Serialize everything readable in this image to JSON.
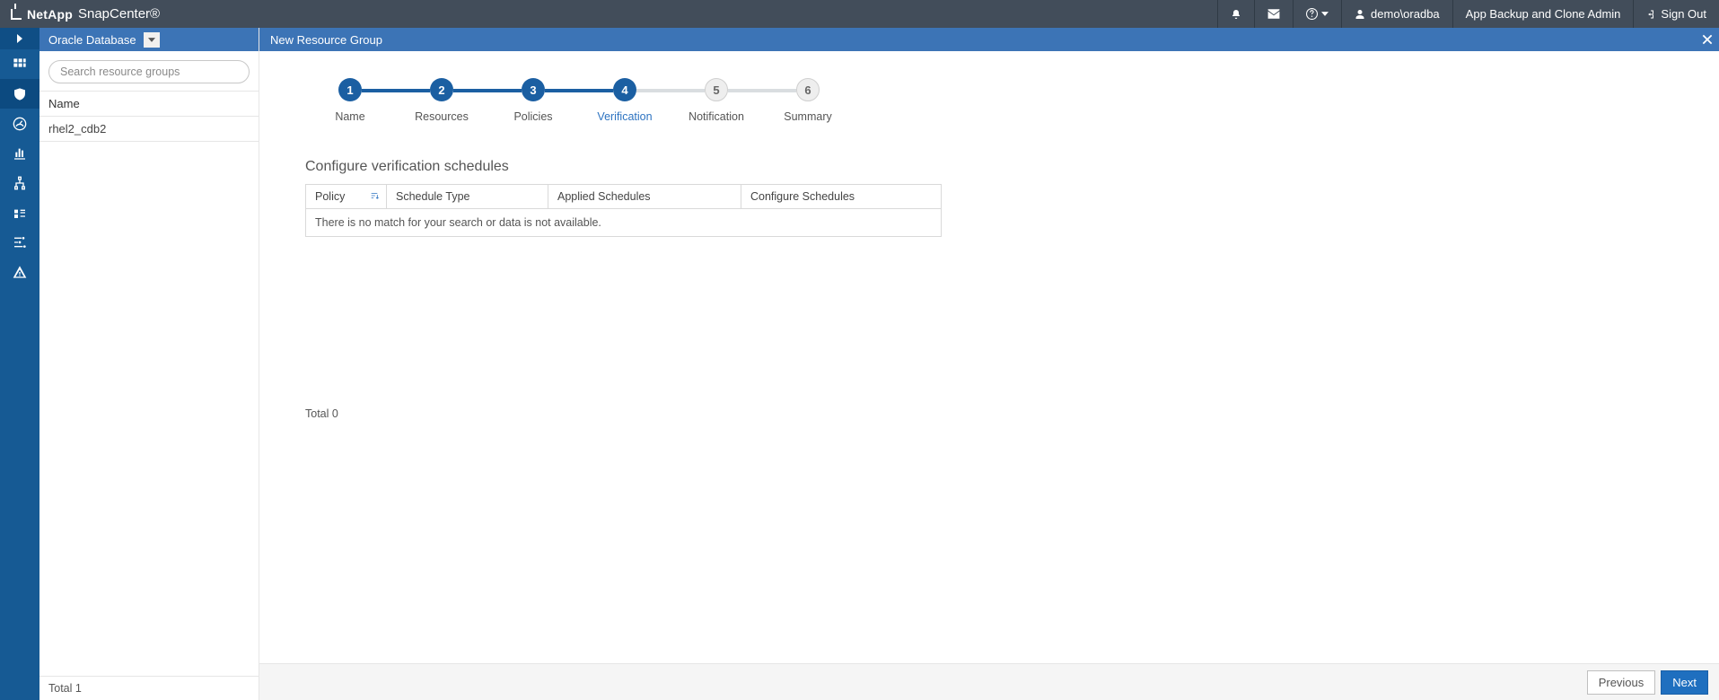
{
  "brand": {
    "company": "NetApp",
    "product": "SnapCenter®"
  },
  "topbar": {
    "user": "demo\\oradba",
    "role": "App Backup and Clone Admin",
    "signout": "Sign Out"
  },
  "selector": {
    "label": "Oracle Database"
  },
  "search": {
    "placeholder": "Search resource groups"
  },
  "list": {
    "header": "Name",
    "items": [
      "rhel2_cdb2"
    ],
    "total_label": "Total 1"
  },
  "wizard": {
    "title": "New Resource Group",
    "steps": [
      {
        "num": "1",
        "label": "Name",
        "state": "done"
      },
      {
        "num": "2",
        "label": "Resources",
        "state": "done"
      },
      {
        "num": "3",
        "label": "Policies",
        "state": "done"
      },
      {
        "num": "4",
        "label": "Verification",
        "state": "current"
      },
      {
        "num": "5",
        "label": "Notification",
        "state": "pending"
      },
      {
        "num": "6",
        "label": "Summary",
        "state": "pending"
      }
    ],
    "section_title": "Configure verification schedules",
    "columns": {
      "policy": "Policy",
      "type": "Schedule Type",
      "applied": "Applied Schedules",
      "configure": "Configure Schedules"
    },
    "empty_msg": "There is no match for your search or data is not available.",
    "total_label": "Total 0",
    "buttons": {
      "prev": "Previous",
      "next": "Next"
    }
  }
}
